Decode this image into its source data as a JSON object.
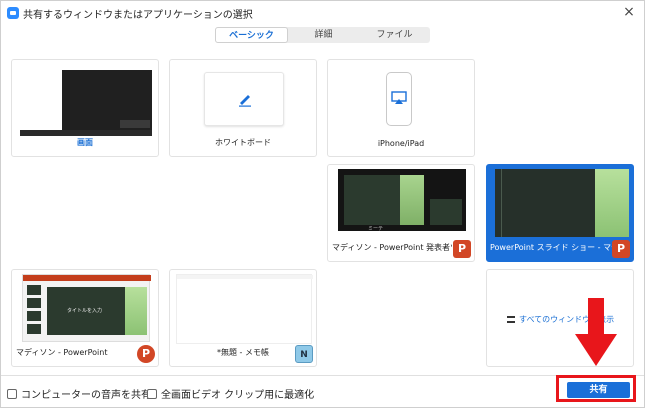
{
  "window": {
    "title": "共有するウィンドウまたはアプリケーションの選択",
    "close_glyph": "×"
  },
  "tabs": [
    {
      "label": "ベーシック",
      "active": true
    },
    {
      "label": "詳細",
      "active": false
    },
    {
      "label": "ファイル",
      "active": false
    }
  ],
  "tiles": [
    {
      "label": "画面",
      "kind": "screen"
    },
    {
      "label": "ホワイトボード",
      "kind": "whiteboard"
    },
    {
      "label": "iPhone/iPad",
      "kind": "device"
    },
    {
      "label": "マディソン - PowerPoint 発表者ツ...",
      "kind": "window",
      "badge": "P"
    },
    {
      "label": "PowerPoint スライド ショー - マディ...",
      "kind": "window",
      "badge": "P",
      "selected": true
    },
    {
      "label": "マディソン - PowerPoint",
      "kind": "window",
      "badge": "P",
      "thumb_text": "タイトルを入力"
    },
    {
      "label": "*無題 - メモ帳",
      "kind": "window",
      "badge": "N"
    },
    {
      "label": "すべてのウィンドウを表示",
      "kind": "show-all"
    }
  ],
  "presenter_thumb_text": "ミーテ",
  "footer": {
    "computer_audio_label": "コンピューターの音声を共有",
    "optimize_video_label": "全画面ビデオ クリップ用に最適化",
    "share_button_label": "共有"
  },
  "colors": {
    "accent": "#1a6fd8",
    "highlight": "#e8161b",
    "powerpoint": "#d24726"
  }
}
